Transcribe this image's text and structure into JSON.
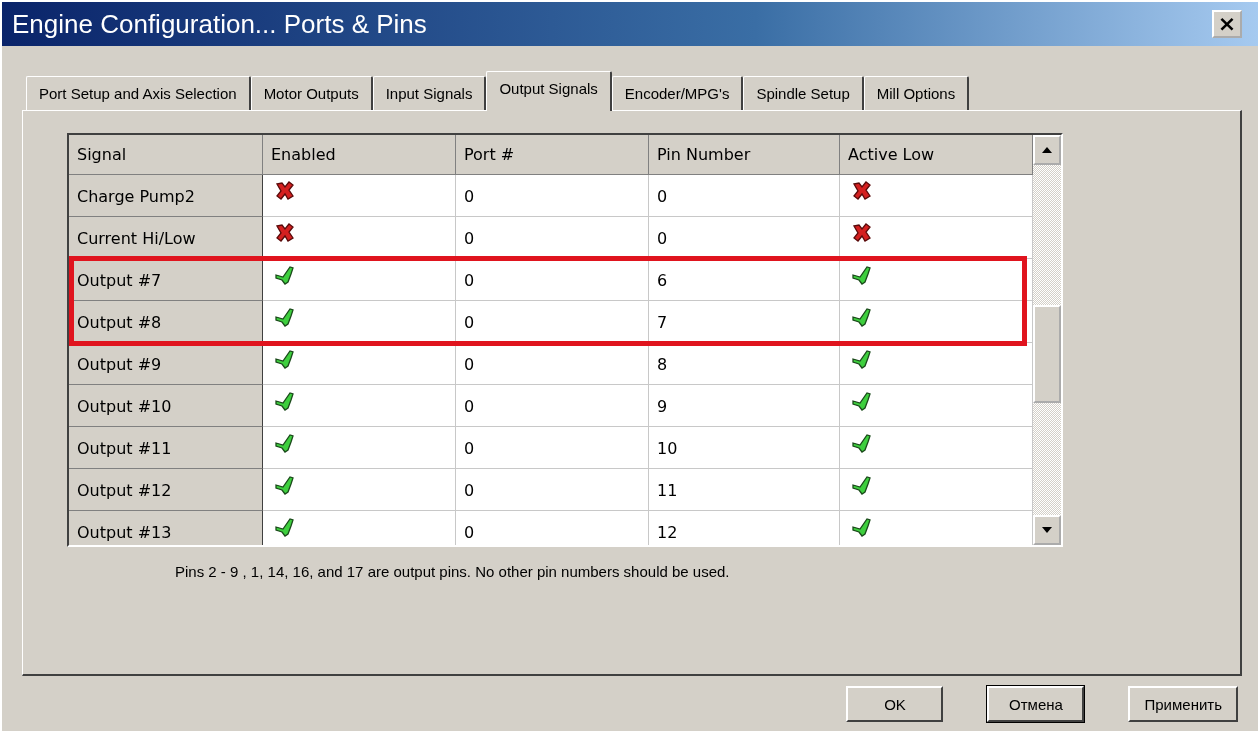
{
  "window": {
    "title": "Engine Configuration... Ports & Pins",
    "close": "×"
  },
  "tabs": [
    {
      "label": "Port Setup and Axis Selection",
      "selected": false
    },
    {
      "label": "Motor Outputs",
      "selected": false
    },
    {
      "label": "Input Signals",
      "selected": false
    },
    {
      "label": "Output Signals",
      "selected": true
    },
    {
      "label": "Encoder/MPG's",
      "selected": false
    },
    {
      "label": "Spindle Setup",
      "selected": false
    },
    {
      "label": "Mill Options",
      "selected": false
    }
  ],
  "table": {
    "columns": [
      "Signal",
      "Enabled",
      "Port #",
      "Pin Number",
      "Active Low"
    ],
    "rows": [
      {
        "signal": "Charge Pump2",
        "enabled": false,
        "port": "0",
        "pin": "0",
        "active_low": false,
        "highlighted": false
      },
      {
        "signal": "Current Hi/Low",
        "enabled": false,
        "port": "0",
        "pin": "0",
        "active_low": false,
        "highlighted": false
      },
      {
        "signal": "Output #7",
        "enabled": true,
        "port": "0",
        "pin": "6",
        "active_low": true,
        "highlighted": true
      },
      {
        "signal": "Output #8",
        "enabled": true,
        "port": "0",
        "pin": "7",
        "active_low": true,
        "highlighted": true
      },
      {
        "signal": "Output #9",
        "enabled": true,
        "port": "0",
        "pin": "8",
        "active_low": true,
        "highlighted": false
      },
      {
        "signal": "Output #10",
        "enabled": true,
        "port": "0",
        "pin": "9",
        "active_low": true,
        "highlighted": false
      },
      {
        "signal": "Output #11",
        "enabled": true,
        "port": "0",
        "pin": "10",
        "active_low": true,
        "highlighted": false
      },
      {
        "signal": "Output #12",
        "enabled": true,
        "port": "0",
        "pin": "11",
        "active_low": true,
        "highlighted": false
      },
      {
        "signal": "Output #13",
        "enabled": true,
        "port": "0",
        "pin": "12",
        "active_low": true,
        "highlighted": false
      }
    ]
  },
  "note": "Pins 2 - 9 , 1, 14, 16, and 17 are output pins. No  other pin numbers should be used.",
  "buttons": [
    {
      "label": "OK",
      "focused": false
    },
    {
      "label": "Отмена",
      "focused": true
    },
    {
      "label": "Применить",
      "focused": false
    }
  ]
}
